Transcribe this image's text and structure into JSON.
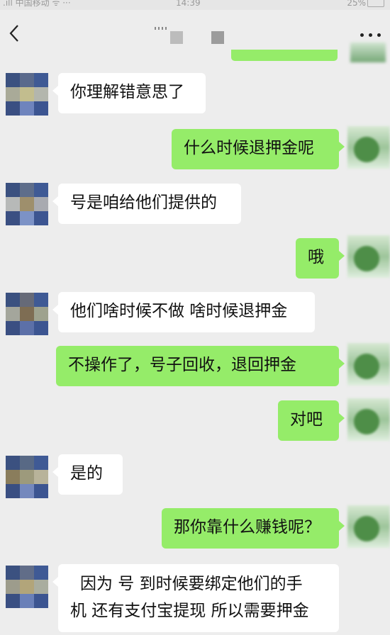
{
  "status_bar": {
    "carrier": ".ıll 中国移动 ᯤ ···",
    "time": "14:39",
    "battery": "25%"
  },
  "nav": {
    "back_icon": "chevron-left-icon",
    "more_icon": "more-dots-icon"
  },
  "messages": [
    {
      "side": "in",
      "text": "你理解错意思了"
    },
    {
      "side": "out",
      "text": "什么时候退押金呢"
    },
    {
      "side": "in",
      "text": "号是咱给他们提供的"
    },
    {
      "side": "out",
      "text": "哦"
    },
    {
      "side": "in",
      "text": "他们啥时候不做 啥时候退押金"
    },
    {
      "side": "out",
      "text": "不操作了，号子回收，退回押金"
    },
    {
      "side": "out",
      "text": "对吧"
    },
    {
      "side": "in",
      "text": "是的"
    },
    {
      "side": "out",
      "text": "那你靠什么赚钱呢？"
    },
    {
      "side": "in",
      "lines": [
        "因为 号 到时候要绑定他们的手",
        "机 还有支付宝提现 所以需要押金"
      ]
    }
  ],
  "colors": {
    "background": "#ededed",
    "bubble_in": "#ffffff",
    "bubble_out": "#95ec69"
  }
}
